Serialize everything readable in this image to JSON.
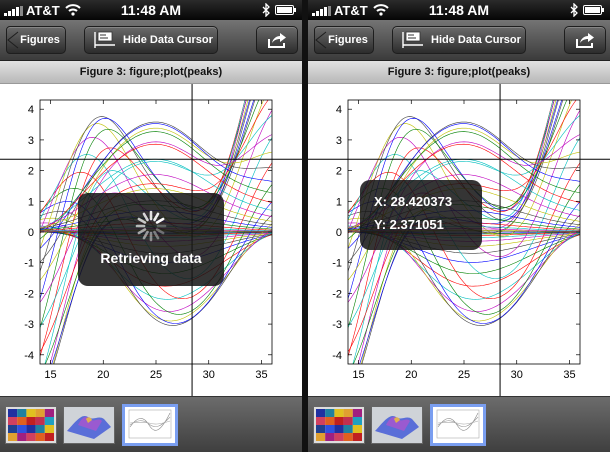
{
  "screens": [
    {
      "status": {
        "carrier": "AT&T",
        "time": "11:48 AM"
      },
      "toolbar": {
        "back_label": "Figures",
        "cursor_label": "Hide Data Cursor"
      },
      "figure_title": "Figure 3: figure;plot(peaks)",
      "hud": {
        "loading_text": "Retrieving data"
      }
    },
    {
      "status": {
        "carrier": "AT&T",
        "time": "11:48 AM"
      },
      "toolbar": {
        "back_label": "Figures",
        "cursor_label": "Hide Data Cursor"
      },
      "figure_title": "Figure 3: figure;plot(peaks)",
      "hud": {
        "x_text": "X: 28.420373",
        "y_text": "Y: 2.371051"
      }
    }
  ],
  "chart_data": {
    "type": "line",
    "x_ticks": [
      15,
      20,
      25,
      30,
      35
    ],
    "y_ticks": [
      -4,
      -3,
      -2,
      -1,
      0,
      1,
      2,
      3,
      4
    ],
    "xlim": [
      14,
      36
    ],
    "ylim": [
      -4.3,
      4.3
    ],
    "crosshair": {
      "x": 28.42,
      "y": 2.371
    },
    "series_count": 49,
    "colors": [
      "#0000ff",
      "#008000",
      "#ff0000",
      "#00bfbf",
      "#bf00bf",
      "#bfbf00",
      "#404040"
    ]
  },
  "theme": {
    "thumbnail_highlight": "#7a9ef0",
    "hud_background": "#141414"
  }
}
